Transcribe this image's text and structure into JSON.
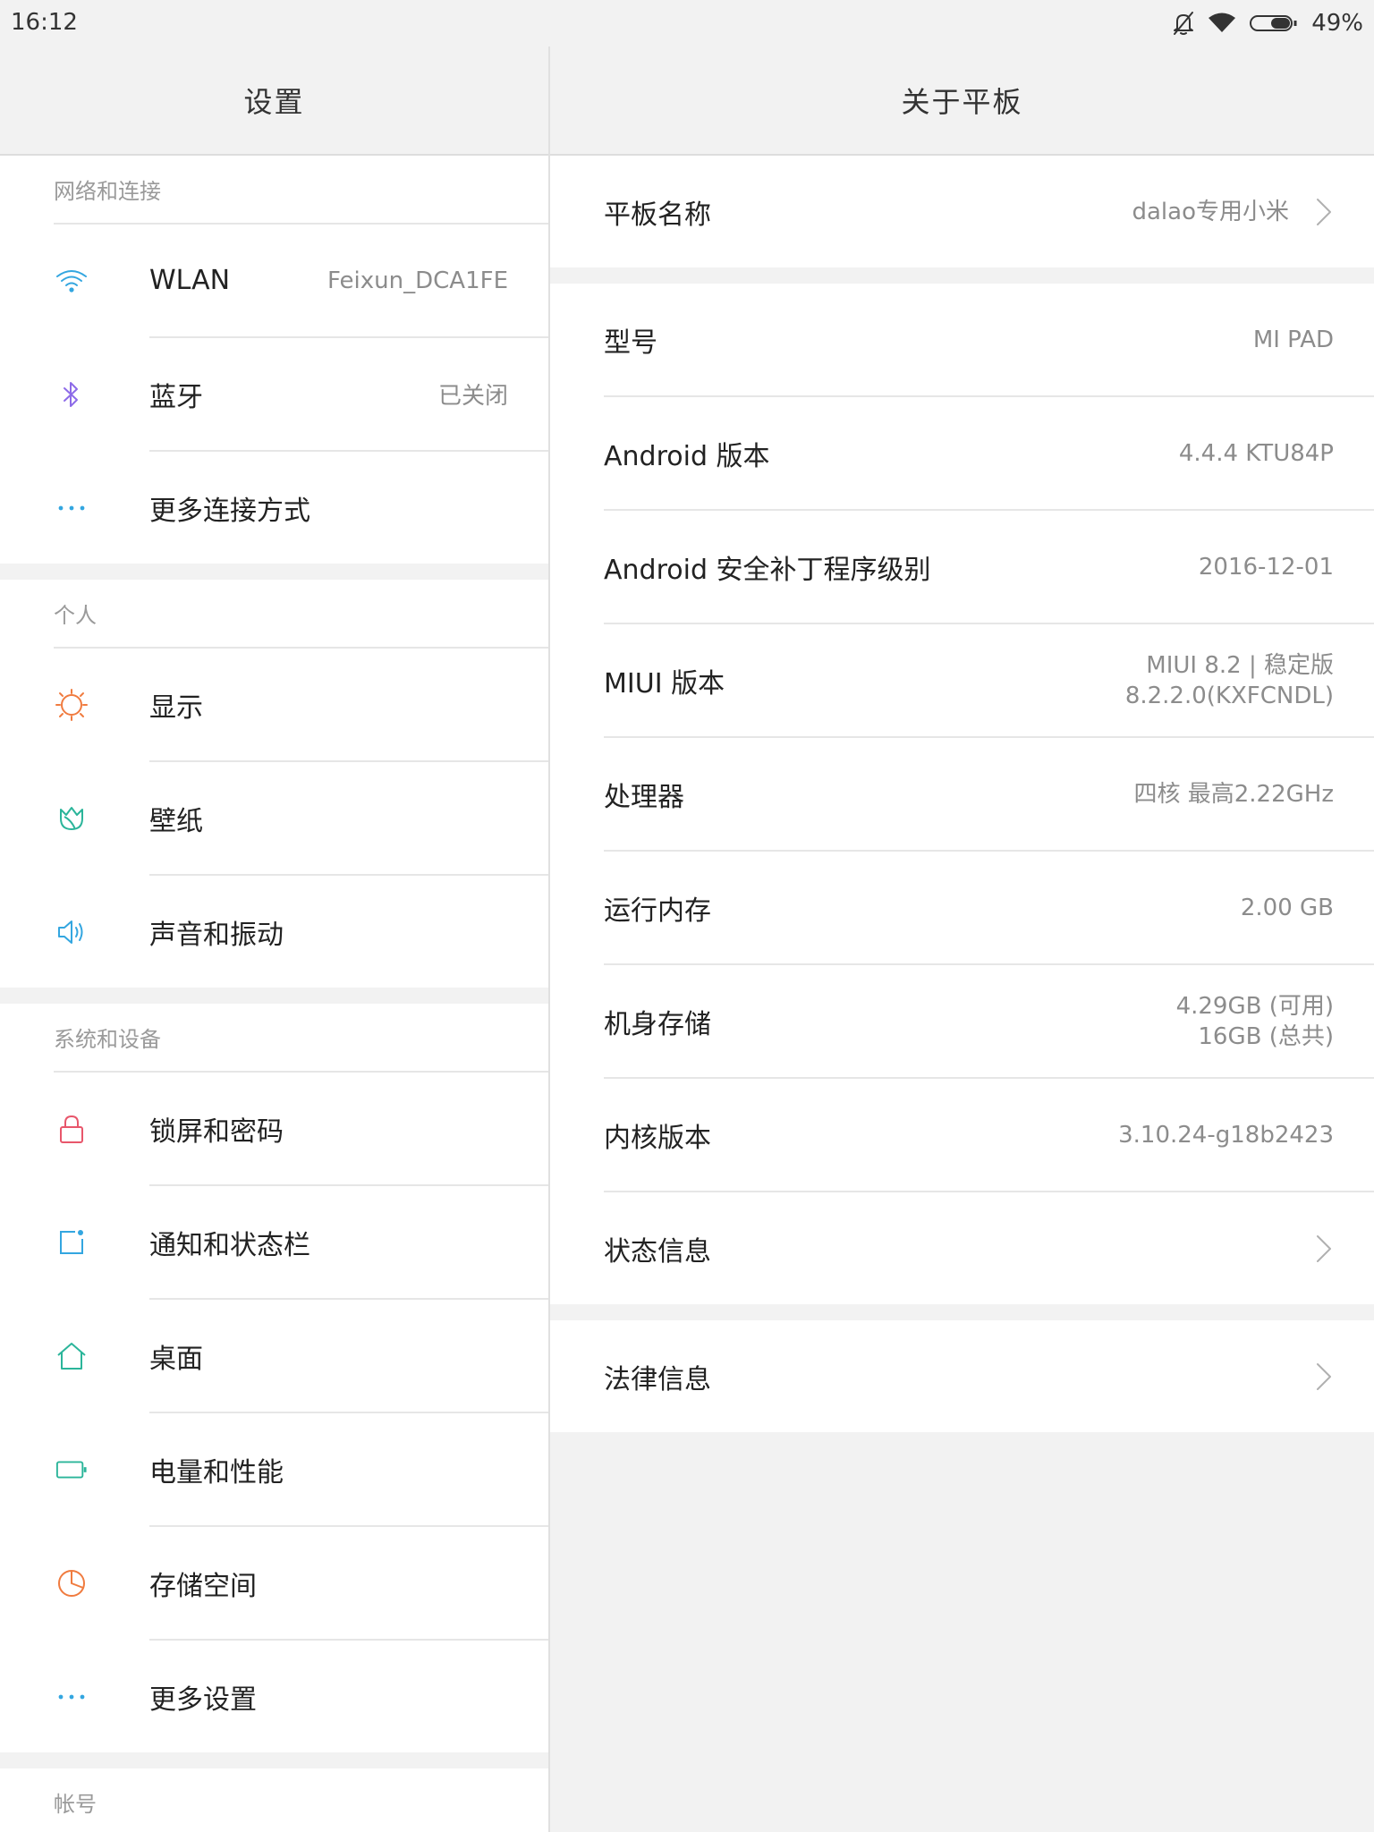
{
  "status": {
    "time": "16:12",
    "battery_pct": "49%",
    "icons": [
      "mute-bell-icon",
      "wifi-icon",
      "battery-icon"
    ]
  },
  "left": {
    "title": "设置",
    "sections": {
      "network": {
        "header": "网络和连接",
        "items": [
          {
            "label": "WLAN",
            "value": "Feixun_DCA1FE",
            "icon": "wifi-icon",
            "color": "#33a6e0"
          },
          {
            "label": "蓝牙",
            "value": "已关闭",
            "icon": "bluetooth-icon",
            "color": "#8d6be8"
          },
          {
            "label": "更多连接方式",
            "icon": "more-dots-icon",
            "color": "#33a6e0"
          }
        ]
      },
      "personal": {
        "header": "个人",
        "items": [
          {
            "label": "显示",
            "icon": "sun-icon",
            "color": "#f07b3f"
          },
          {
            "label": "壁纸",
            "icon": "tulip-icon",
            "color": "#2bb59a"
          },
          {
            "label": "声音和振动",
            "icon": "speaker-icon",
            "color": "#33a6e0"
          }
        ]
      },
      "system": {
        "header": "系统和设备",
        "items": [
          {
            "label": "锁屏和密码",
            "icon": "lock-icon",
            "color": "#e8566b"
          },
          {
            "label": "通知和状态栏",
            "icon": "notification-icon",
            "color": "#33a6e0"
          },
          {
            "label": "桌面",
            "icon": "home-icon",
            "color": "#2bb59a"
          },
          {
            "label": "电量和性能",
            "icon": "battery-icon",
            "color": "#2bb59a"
          },
          {
            "label": "存储空间",
            "icon": "pie-chart-icon",
            "color": "#f07b3f"
          },
          {
            "label": "更多设置",
            "icon": "more-dots-icon",
            "color": "#33a6e0"
          }
        ]
      },
      "account": {
        "header": "帐号"
      }
    }
  },
  "right": {
    "title": "关于平板",
    "device_name": {
      "label": "平板名称",
      "value": "dalao专用小米"
    },
    "info": [
      {
        "label": "型号",
        "value": "MI PAD"
      },
      {
        "label": "Android 版本",
        "value": "4.4.4 KTU84P"
      },
      {
        "label": "Android 安全补丁程序级别",
        "value": "2016-12-01"
      },
      {
        "label": "MIUI 版本",
        "value_line1": "MIUI 8.2 | 稳定版",
        "value_line2": "8.2.2.0(KXFCNDL)"
      },
      {
        "label": "处理器",
        "value": "四核 最高2.22GHz"
      },
      {
        "label": "运行内存",
        "value": "2.00 GB"
      },
      {
        "label": "机身存储",
        "value_line1": "4.29GB (可用)",
        "value_line2": "16GB (总共)"
      },
      {
        "label": "内核版本",
        "value": "3.10.24-g18b2423"
      },
      {
        "label": "状态信息"
      }
    ],
    "legal": {
      "label": "法律信息"
    }
  }
}
